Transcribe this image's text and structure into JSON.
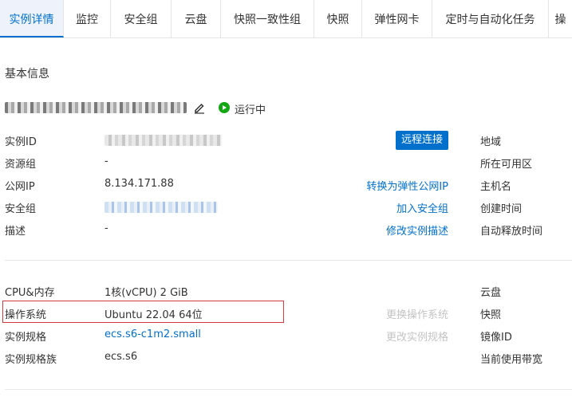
{
  "tabs": [
    "实例详情",
    "监控",
    "安全组",
    "云盘",
    "快照一致性组",
    "快照",
    "弹性网卡",
    "定时与自动化任务",
    "操"
  ],
  "section_title": "基本信息",
  "instance": {
    "status": "运行中",
    "status_color": "#13a813"
  },
  "basic_info": {
    "instance_id_label": "实例ID",
    "resource_group_label": "资源组",
    "resource_group_value": "-",
    "public_ip_label": "公网IP",
    "public_ip_value": "8.134.171.88",
    "security_group_label": "安全组",
    "description_label": "描述",
    "description_value": "-"
  },
  "actions": {
    "remote_connect": "远程连接",
    "convert_eip": "转换为弹性公网IP",
    "join_security_group": "加入安全组",
    "modify_description": "修改实例描述",
    "change_os": "更换操作系统",
    "change_spec": "更改实例规格"
  },
  "right_labels": {
    "region": "地域",
    "zone": "所在可用区",
    "hostname": "主机名",
    "created_time": "创建时间",
    "auto_release_time": "自动释放时间",
    "disk": "云盘",
    "snapshot": "快照",
    "image_id": "镜像ID",
    "bandwidth": "当前使用带宽"
  },
  "config": {
    "cpu_mem_label": "CPU&内存",
    "cpu_mem_value": "1核(vCPU) 2 GiB",
    "os_label": "操作系统",
    "os_value": "Ubuntu 22.04 64位",
    "spec_label": "实例规格",
    "spec_value": "ecs.s6-c1m2.small",
    "spec_family_label": "实例规格族",
    "spec_family_value": "ecs.s6"
  },
  "colors": {
    "accent": "#0070cc",
    "highlight_border": "#d9363e",
    "disabled_text": "#c4c4c4"
  }
}
